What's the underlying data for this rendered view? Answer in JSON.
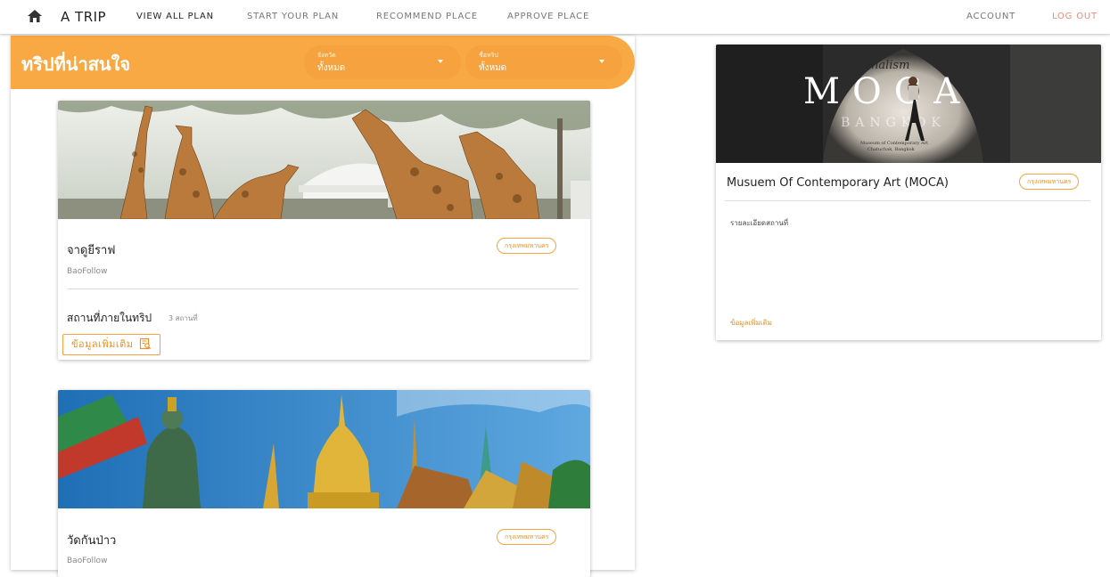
{
  "nav": {
    "brand": "A TRIP",
    "items": [
      "VIEW ALL PLAN",
      "START YOUR PLAN",
      "RECOMMEND PLACE",
      "APPROVE PLACE"
    ],
    "account": "ACCOUNT",
    "logout": "LOG OUT"
  },
  "filters": {
    "title": "ทริปที่น่าสนใจ",
    "province": {
      "label": "จังหวัด",
      "value": "ทั้งหมด"
    },
    "trip_name": {
      "label": "ชื่อทริป",
      "value": "ทั้งหมด"
    }
  },
  "trips": [
    {
      "name": "จาดูยีราฟ",
      "owner": "BaoFollow",
      "province": "กรุงเทพมหานคร",
      "places_label": "สถานที่ภายในทริป",
      "places_count": "3 สถานที่",
      "more_label": "ข้อมูลเพิ่มเติม"
    },
    {
      "name": "วัดกันป่าว",
      "owner": "BaoFollow",
      "province": "กรุงเทพมหานคร"
    }
  ],
  "place": {
    "title": "Musuem Of Contemporary Art (MOCA)",
    "province": "กรุงเทพมหานคร",
    "detail": "รายละเอียดสถานที่",
    "more_label": "ข้อมูลเพิ่มเติม",
    "image_text": {
      "script": "Minimalism",
      "big": "MOCA",
      "city": "BANGKOK",
      "caption1": "Museum of Contemporary Art",
      "caption2": "Chatuchak, Bangkok"
    }
  },
  "colors": {
    "accent": "#f8a944",
    "chip": "#e8922a",
    "logout": "#f08a7a"
  },
  "icons": {
    "home": "home-icon",
    "more": "document-search-icon",
    "caret": "chevron-down-icon"
  }
}
